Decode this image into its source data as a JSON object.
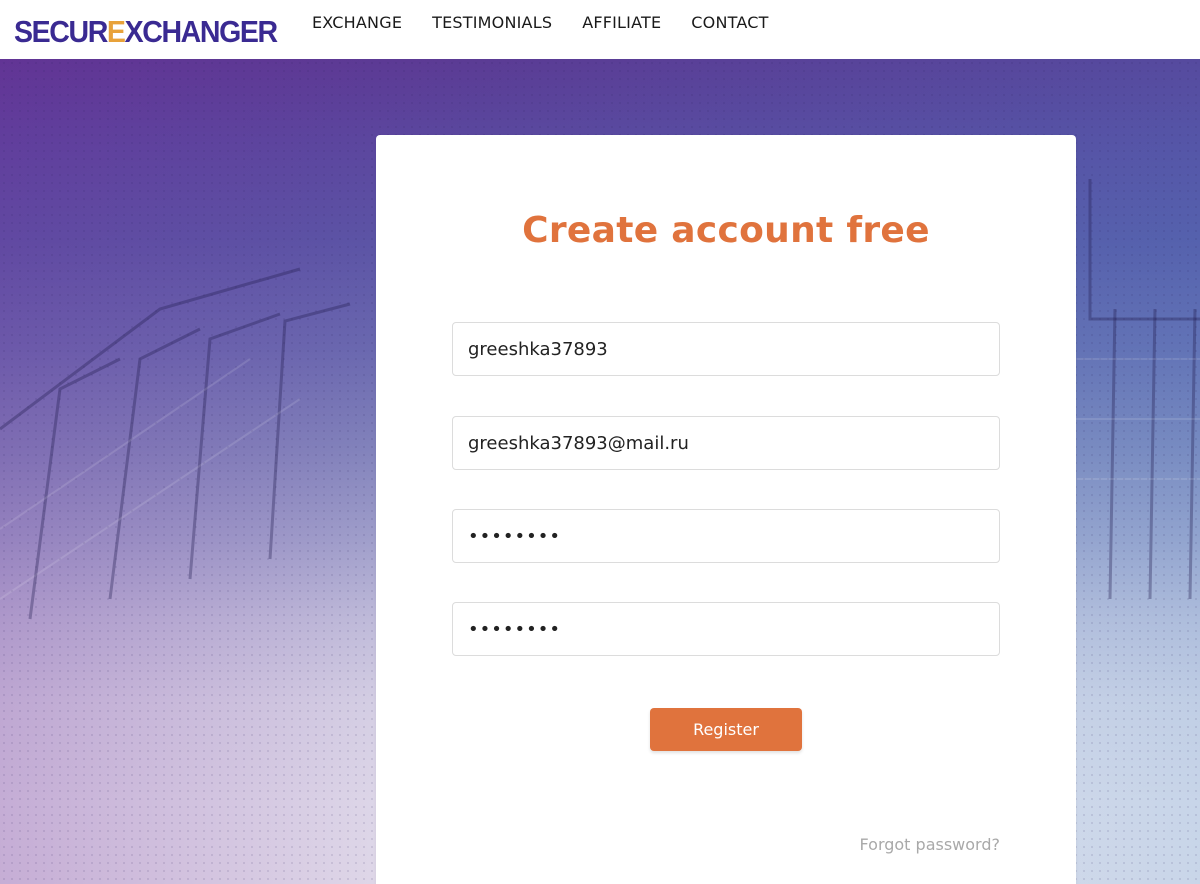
{
  "header": {
    "logo_prefix": "SECUR",
    "logo_accent": "E",
    "logo_suffix": "XCHANGER",
    "nav": [
      {
        "label": "EXCHANGE"
      },
      {
        "label": "TESTIMONIALS"
      },
      {
        "label": "AFFILIATE"
      },
      {
        "label": "CONTACT"
      }
    ]
  },
  "form": {
    "title": "Create account free",
    "username_value": "greeshka37893",
    "email_value": "greeshka37893@mail.ru",
    "password_value": "12345678",
    "confirm_password_value": "12345678",
    "register_label": "Register",
    "forgot_label": "Forgot password?"
  },
  "colors": {
    "accent": "#e0733d",
    "logo": "#3a2a92",
    "logo_accent": "#e8a23a"
  }
}
